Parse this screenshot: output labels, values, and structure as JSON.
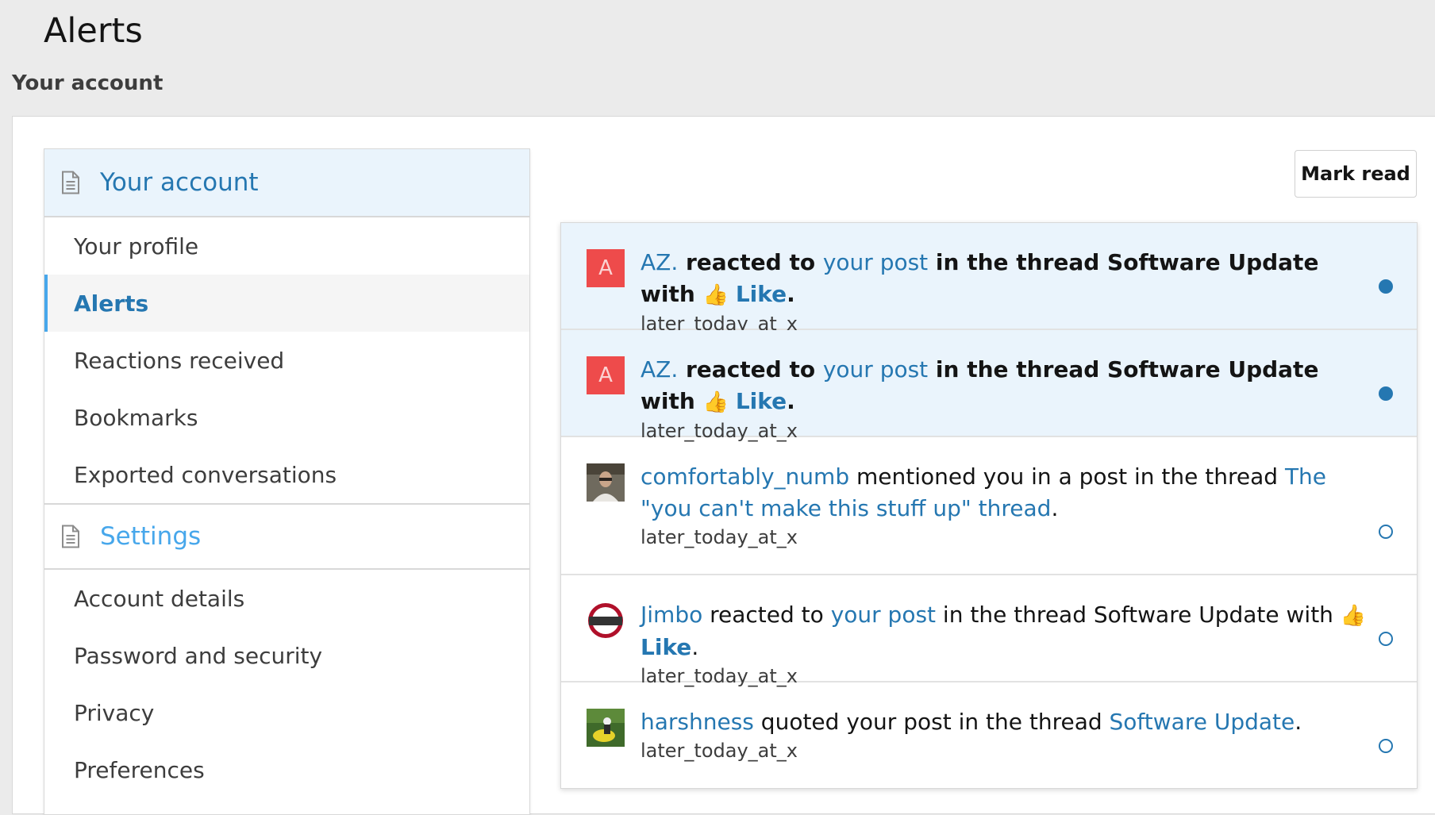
{
  "page": {
    "title": "Alerts",
    "breadcrumb": "Your account"
  },
  "sidebar": {
    "account_header": "Your account",
    "account_items": [
      {
        "label": "Your profile"
      },
      {
        "label": "Alerts"
      },
      {
        "label": "Reactions received"
      },
      {
        "label": "Bookmarks"
      },
      {
        "label": "Exported conversations"
      }
    ],
    "settings_header": "Settings",
    "settings_items": [
      {
        "label": "Account details"
      },
      {
        "label": "Password and security"
      },
      {
        "label": "Privacy"
      },
      {
        "label": "Preferences"
      }
    ],
    "active_item": "Alerts"
  },
  "toolbar": {
    "mark_read_label": "Mark read"
  },
  "alerts": [
    {
      "avatar_letter": "A",
      "user": "AZ.",
      "t1": " reacted to ",
      "link1": "your post",
      "t2": " in the thread Software Update with ",
      "reaction": "Like",
      "end": ".",
      "time": "later_today_at_x"
    },
    {
      "avatar_letter": "A",
      "user": "AZ.",
      "t1": " reacted to ",
      "link1": "your post",
      "t2": " in the thread Software Update with ",
      "reaction": "Like",
      "end": ".",
      "time": "later_today_at_x"
    },
    {
      "user": "comfortably_numb",
      "t1": " mentioned you in a post in the thread ",
      "link1": "The \"you can't make this stuff up\" thread",
      "end": ".",
      "time": "later_today_at_x"
    },
    {
      "user": "Jimbo",
      "t1": " reacted to ",
      "link1": "your post",
      "t2": " in the thread Software Update with ",
      "reaction": "Like",
      "end": ".",
      "time": "later_today_at_x"
    },
    {
      "user": "harshness",
      "t1": " quoted your post in the thread ",
      "link1": "Software Update",
      "end": ".",
      "time": "later_today_at_x"
    }
  ],
  "colors": {
    "link": "#2577b1",
    "accent": "#47a7eb",
    "unread_bg": "#eaf4fc",
    "letter_avatar": "#ee4b4b"
  }
}
